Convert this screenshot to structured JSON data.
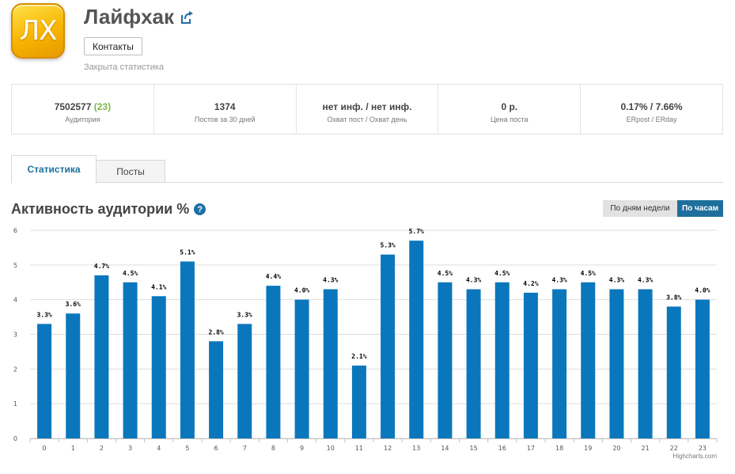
{
  "header": {
    "logo_text": "ЛХ",
    "title": "Лайфхак",
    "contacts_label": "Контакты",
    "closed_stats": "Закрыта статистика"
  },
  "stats": [
    {
      "value": "7502577",
      "extra": "(23)",
      "label": "Аудитория"
    },
    {
      "value": "1374",
      "label": "Постов за 30 дней"
    },
    {
      "value": "нет инф. / нет инф.",
      "label": "Охват пост / Охват день"
    },
    {
      "value": "0 р.",
      "label": "Цена поста"
    },
    {
      "value": "0.17% / 7.66%",
      "label": "ERpost / ERday"
    }
  ],
  "tabs": {
    "active": "Статистика",
    "inactive": "Посты"
  },
  "section": {
    "title": "Активность аудитории %",
    "help": "?",
    "toggle_days": "По дням недели",
    "toggle_hours": "По часам"
  },
  "colors": {
    "bar": "#0a77bd",
    "grid": "#dddddd",
    "accent": "#1f6f9c",
    "green": "#7ab648"
  },
  "chart_data": {
    "type": "bar",
    "categories": [
      "0",
      "1",
      "2",
      "3",
      "4",
      "5",
      "6",
      "7",
      "8",
      "9",
      "10",
      "11",
      "12",
      "13",
      "14",
      "15",
      "16",
      "17",
      "18",
      "19",
      "20",
      "21",
      "22",
      "23"
    ],
    "values": [
      3.3,
      3.6,
      4.7,
      4.5,
      4.1,
      5.1,
      2.8,
      3.3,
      4.4,
      4.0,
      4.3,
      2.1,
      5.3,
      5.7,
      4.5,
      4.3,
      4.5,
      4.2,
      4.3,
      4.5,
      4.3,
      4.3,
      3.8,
      4.0
    ],
    "data_labels": [
      "3.3%",
      "3.6%",
      "4.7%",
      "4.5%",
      "4.1%",
      "5.1%",
      "2.8%",
      "3.3%",
      "4.4%",
      "4.0%",
      "4.3%",
      "2.1%",
      "5.3%",
      "5.7%",
      "4.5%",
      "4.3%",
      "4.5%",
      "4.2%",
      "4.3%",
      "4.5%",
      "4.3%",
      "4.3%",
      "3.8%",
      "4.0%"
    ],
    "yticks": [
      "0",
      "1",
      "2",
      "3",
      "4",
      "5",
      "6"
    ],
    "ylim": [
      0,
      6
    ],
    "grid": true,
    "credit": "Highcharts.com"
  }
}
